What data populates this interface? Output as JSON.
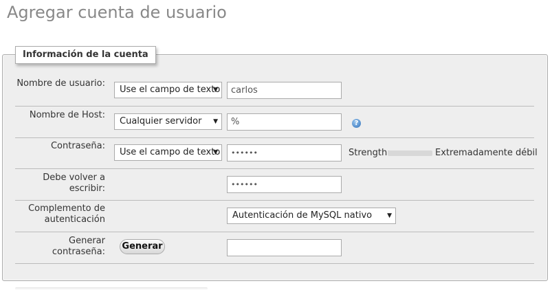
{
  "page": {
    "title": "Agregar cuenta de usuario"
  },
  "fieldset": {
    "legend": "Información de la cuenta"
  },
  "username": {
    "label": "Nombre de usuario:",
    "select_value": "Use el campo de texto",
    "input_value": "carlos"
  },
  "hostname": {
    "label": "Nombre de Host:",
    "select_value": "Cualquier servidor",
    "input_value": "%",
    "help_icon": "help-icon"
  },
  "password": {
    "label": "Contraseña:",
    "select_value": "Use el campo de texto",
    "input_value": "••••••",
    "strength_label": "Strength:",
    "strength_value": "Extremadamente débil",
    "strength_level": 0
  },
  "retype": {
    "label": "Debe volver a escribir:",
    "input_value": "••••••"
  },
  "auth_plugin": {
    "label_line1": "Complemento de",
    "label_line2": "autenticación",
    "select_value": "Autenticación de MySQL nativo"
  },
  "generate": {
    "label": "Generar contraseña:",
    "button_label": "Generar",
    "input_value": ""
  }
}
